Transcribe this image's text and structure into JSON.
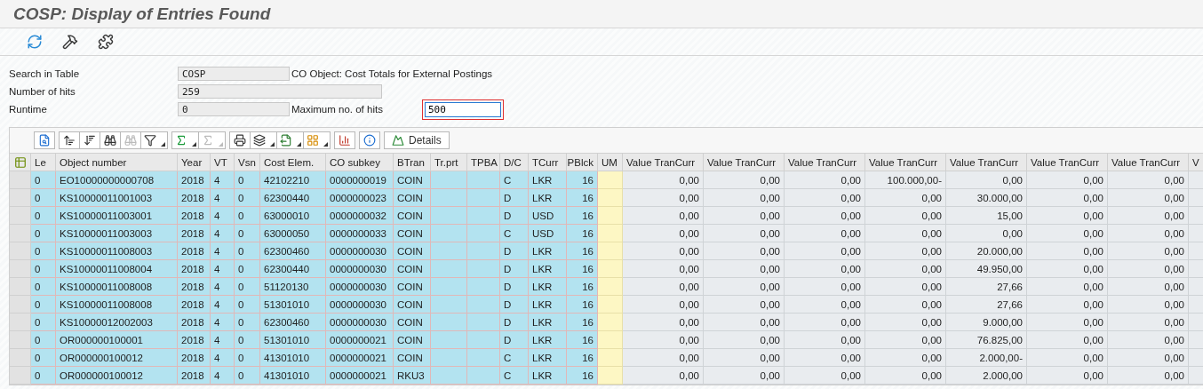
{
  "window": {
    "title": "COSP: Display of Entries Found"
  },
  "toolbar": [
    {
      "kind": "refresh"
    },
    {
      "kind": "tools"
    },
    {
      "kind": "puzzle"
    }
  ],
  "form": {
    "search_in_table": {
      "label": "Search in Table",
      "value": "COSP",
      "description": "CO Object: Cost Totals for External Postings"
    },
    "number_of_hits": {
      "label": "Number of hits",
      "value": "259"
    },
    "runtime": {
      "label": "Runtime",
      "value": "0"
    },
    "maximum_hits": {
      "label": "Maximum no. of hits",
      "value": "500",
      "focused": true
    }
  },
  "alv_toolbar": [
    [
      {
        "kind": "details",
        "disabled": false,
        "dropdown": false
      }
    ],
    [
      {
        "kind": "sort_asc",
        "disabled": false,
        "dropdown": false
      },
      {
        "kind": "sort_desc",
        "disabled": false,
        "dropdown": false
      },
      {
        "kind": "find",
        "disabled": false,
        "dropdown": false
      },
      {
        "kind": "find_next",
        "disabled": true,
        "dropdown": false
      },
      {
        "kind": "filter",
        "disabled": false,
        "dropdown": true
      }
    ],
    [
      {
        "kind": "sum",
        "disabled": false,
        "dropdown": true
      },
      {
        "kind": "subtotal",
        "disabled": true,
        "dropdown": true
      }
    ],
    [
      {
        "kind": "print",
        "disabled": false,
        "dropdown": false
      },
      {
        "kind": "views",
        "disabled": false,
        "dropdown": true
      },
      {
        "kind": "export",
        "disabled": false,
        "dropdown": true
      },
      {
        "kind": "layout",
        "disabled": false,
        "dropdown": true
      }
    ],
    [
      {
        "kind": "chart",
        "disabled": false,
        "dropdown": false
      }
    ],
    [
      {
        "kind": "info",
        "disabled": false,
        "dropdown": false
      }
    ],
    [
      {
        "kind": "details_button",
        "disabled": false,
        "dropdown": false,
        "label": "Details"
      }
    ]
  ],
  "table": {
    "columns": [
      {
        "label": "Le",
        "kind": "key"
      },
      {
        "label": "Object number",
        "kind": "key"
      },
      {
        "label": "Year",
        "kind": "key"
      },
      {
        "label": "VT",
        "kind": "key"
      },
      {
        "label": "Vsn",
        "kind": "key"
      },
      {
        "label": "Cost Elem.",
        "kind": "key"
      },
      {
        "label": "CO subkey",
        "kind": "key"
      },
      {
        "label": "BTran",
        "kind": "key"
      },
      {
        "label": "Tr.prt",
        "kind": "key"
      },
      {
        "label": "TPBA",
        "kind": "key"
      },
      {
        "label": "D/C",
        "kind": "key"
      },
      {
        "label": "TCurr",
        "kind": "key"
      },
      {
        "label": "PBlck",
        "kind": "key_number"
      },
      {
        "label": "UM",
        "kind": "unit"
      },
      {
        "label": "Value TranCurr",
        "kind": "value"
      },
      {
        "label": "Value TranCurr",
        "kind": "value"
      },
      {
        "label": "Value TranCurr",
        "kind": "value"
      },
      {
        "label": "Value TranCurr",
        "kind": "value"
      },
      {
        "label": "Value TranCurr",
        "kind": "value"
      },
      {
        "label": "Value TranCurr",
        "kind": "value"
      },
      {
        "label": "Value TranCurr",
        "kind": "value"
      },
      {
        "label": "V",
        "kind": "value"
      }
    ],
    "rows": [
      [
        "0",
        "EO10000000000708",
        "2018",
        "4",
        "0",
        "42102210",
        "0000000019",
        "COIN",
        null,
        null,
        "C",
        "LKR",
        "16",
        null,
        "0,00",
        "0,00",
        "0,00",
        "100.000,00-",
        "0,00",
        "0,00",
        "0,00",
        null
      ],
      [
        "0",
        "KS10000011001003",
        "2018",
        "4",
        "0",
        "62300440",
        "0000000023",
        "COIN",
        null,
        null,
        "D",
        "LKR",
        "16",
        null,
        "0,00",
        "0,00",
        "0,00",
        "0,00",
        "30.000,00",
        "0,00",
        "0,00",
        null
      ],
      [
        "0",
        "KS10000011003001",
        "2018",
        "4",
        "0",
        "63000010",
        "0000000032",
        "COIN",
        null,
        null,
        "D",
        "USD",
        "16",
        null,
        "0,00",
        "0,00",
        "0,00",
        "0,00",
        "15,00",
        "0,00",
        "0,00",
        null
      ],
      [
        "0",
        "KS10000011003003",
        "2018",
        "4",
        "0",
        "63000050",
        "0000000033",
        "COIN",
        null,
        null,
        "C",
        "USD",
        "16",
        null,
        "0,00",
        "0,00",
        "0,00",
        "0,00",
        "0,00",
        "0,00",
        "0,00",
        null
      ],
      [
        "0",
        "KS10000011008003",
        "2018",
        "4",
        "0",
        "62300460",
        "0000000030",
        "COIN",
        null,
        null,
        "D",
        "LKR",
        "16",
        null,
        "0,00",
        "0,00",
        "0,00",
        "0,00",
        "20.000,00",
        "0,00",
        "0,00",
        null
      ],
      [
        "0",
        "KS10000011008004",
        "2018",
        "4",
        "0",
        "62300440",
        "0000000030",
        "COIN",
        null,
        null,
        "D",
        "LKR",
        "16",
        null,
        "0,00",
        "0,00",
        "0,00",
        "0,00",
        "49.950,00",
        "0,00",
        "0,00",
        null
      ],
      [
        "0",
        "KS10000011008008",
        "2018",
        "4",
        "0",
        "51120130",
        "0000000030",
        "COIN",
        null,
        null,
        "D",
        "LKR",
        "16",
        null,
        "0,00",
        "0,00",
        "0,00",
        "0,00",
        "27,66",
        "0,00",
        "0,00",
        null
      ],
      [
        "0",
        "KS10000011008008",
        "2018",
        "4",
        "0",
        "51301010",
        "0000000030",
        "COIN",
        null,
        null,
        "D",
        "LKR",
        "16",
        null,
        "0,00",
        "0,00",
        "0,00",
        "0,00",
        "27,66",
        "0,00",
        "0,00",
        null
      ],
      [
        "0",
        "KS10000012002003",
        "2018",
        "4",
        "0",
        "62300460",
        "0000000030",
        "COIN",
        null,
        null,
        "D",
        "LKR",
        "16",
        null,
        "0,00",
        "0,00",
        "0,00",
        "0,00",
        "9.000,00",
        "0,00",
        "0,00",
        null
      ],
      [
        "0",
        "OR000000100001",
        "2018",
        "4",
        "0",
        "51301010",
        "0000000021",
        "COIN",
        null,
        null,
        "D",
        "LKR",
        "16",
        null,
        "0,00",
        "0,00",
        "0,00",
        "0,00",
        "76.825,00",
        "0,00",
        "0,00",
        null
      ],
      [
        "0",
        "OR000000100012",
        "2018",
        "4",
        "0",
        "41301010",
        "0000000021",
        "COIN",
        null,
        null,
        "C",
        "LKR",
        "16",
        null,
        "0,00",
        "0,00",
        "0,00",
        "0,00",
        "2.000,00-",
        "0,00",
        "0,00",
        null
      ],
      [
        "0",
        "OR000000100012",
        "2018",
        "4",
        "0",
        "41301010",
        "0000000021",
        "RKU3",
        null,
        null,
        "C",
        "LKR",
        "16",
        null,
        "0,00",
        "0,00",
        "0,00",
        "0,00",
        "2.000,00",
        "0,00",
        "0,00",
        null
      ]
    ]
  }
}
